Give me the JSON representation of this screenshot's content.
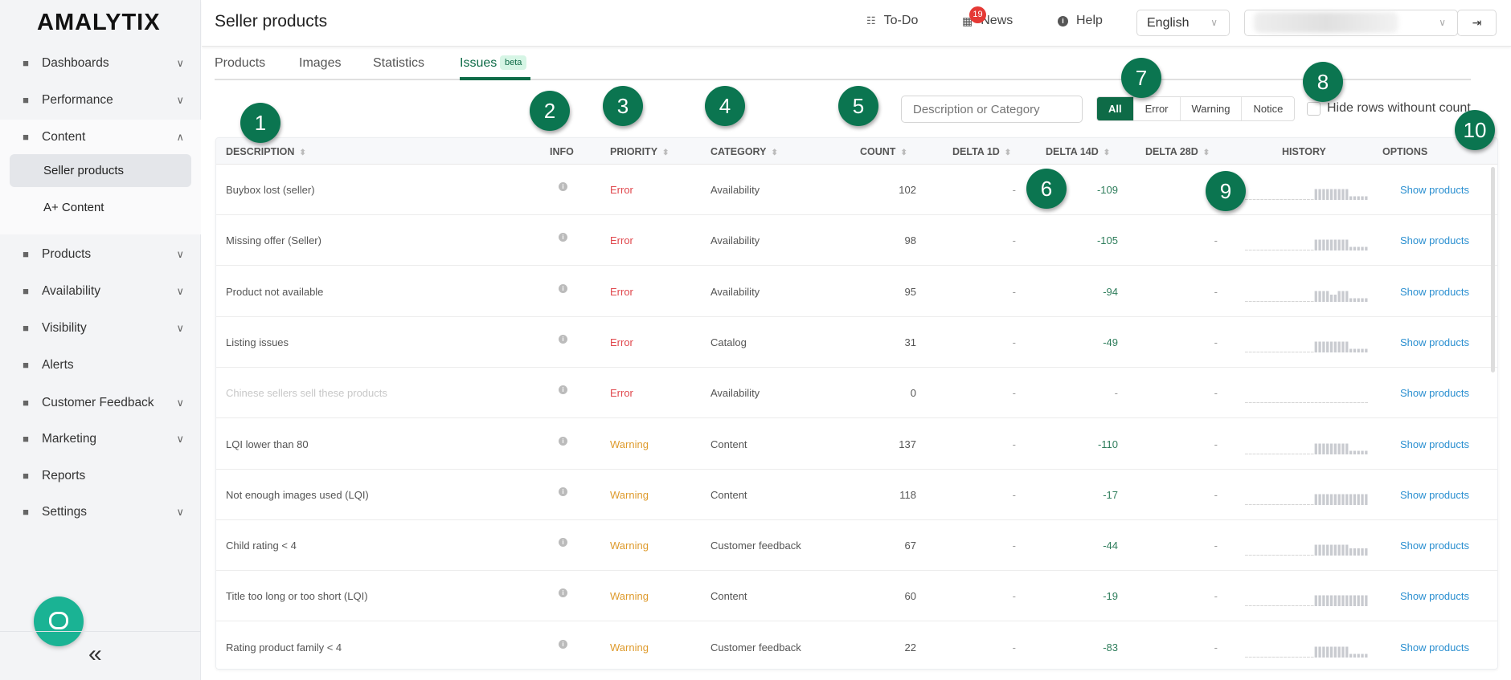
{
  "brand": "AMALYTIX",
  "colors": {
    "accent": "#0e6b47",
    "error": "#e0474c",
    "warning": "#de9a2b",
    "delta": "#2e7d5b",
    "link": "#2a8fd0",
    "callout": "#0b7550"
  },
  "sidebar": {
    "items": [
      {
        "label": "Dashboards",
        "icon": "server-icon",
        "chevron": "down"
      },
      {
        "label": "Performance",
        "icon": "gauge-icon",
        "chevron": "down"
      },
      {
        "label": "Content",
        "icon": "id-card-icon",
        "chevron": "up",
        "children": [
          {
            "label": "Seller products",
            "active": true
          },
          {
            "label": "A+ Content"
          }
        ]
      },
      {
        "label": "Products",
        "icon": "list-icon",
        "chevron": "down"
      },
      {
        "label": "Availability",
        "icon": "thermometer-icon",
        "chevron": "down"
      },
      {
        "label": "Visibility",
        "icon": "search-icon",
        "chevron": "down"
      },
      {
        "label": "Alerts",
        "icon": "bell-icon"
      },
      {
        "label": "Customer Feedback",
        "icon": "star-icon",
        "chevron": "down"
      },
      {
        "label": "Marketing",
        "icon": "megaphone-icon",
        "chevron": "down"
      },
      {
        "label": "Reports",
        "icon": "table-icon"
      },
      {
        "label": "Settings",
        "icon": "sliders-icon",
        "chevron": "down"
      }
    ],
    "collapse": "«"
  },
  "header": {
    "title": "Seller products",
    "todo": "To-Do",
    "news": "News",
    "news_badge": "19",
    "help": "Help",
    "language": "English"
  },
  "tabs": [
    {
      "label": "Products"
    },
    {
      "label": "Images"
    },
    {
      "label": "Statistics"
    },
    {
      "label": "Issues",
      "active": true,
      "badge": "beta"
    }
  ],
  "filters": {
    "search_placeholder": "Description or Category",
    "priority": [
      "All",
      "Error",
      "Warning",
      "Notice"
    ],
    "selected": "All",
    "hide_label": "Hide rows withount count",
    "hide_checked": false
  },
  "columns": [
    "DESCRIPTION",
    "INFO",
    "PRIORITY",
    "CATEGORY",
    "COUNT",
    "DELTA 1D",
    "DELTA 14D",
    "DELTA 28D",
    "HISTORY",
    "OPTIONS"
  ],
  "rows": [
    {
      "description": "Buybox lost (seller)",
      "priority": "Error",
      "category": "Availability",
      "count": "102",
      "d1": "-",
      "d14": "-109",
      "d28": "",
      "history": [
        0,
        0,
        0,
        0,
        0,
        0,
        0,
        0,
        0,
        0,
        0,
        0,
        0,
        0,
        0,
        0,
        0,
        0,
        3,
        3,
        3,
        3,
        3,
        3,
        3,
        3,
        3,
        1,
        1,
        1,
        1,
        1
      ],
      "option": "Show products"
    },
    {
      "description": "Missing offer (Seller)",
      "priority": "Error",
      "category": "Availability",
      "count": "98",
      "d1": "-",
      "d14": "-105",
      "d28": "-",
      "history": [
        0,
        0,
        0,
        0,
        0,
        0,
        0,
        0,
        0,
        0,
        0,
        0,
        0,
        0,
        0,
        0,
        0,
        0,
        3,
        3,
        3,
        3,
        3,
        3,
        3,
        3,
        3,
        1,
        1,
        1,
        1,
        1
      ],
      "option": "Show products"
    },
    {
      "description": "Product not available",
      "priority": "Error",
      "category": "Availability",
      "count": "95",
      "d1": "-",
      "d14": "-94",
      "d28": "-",
      "history": [
        0,
        0,
        0,
        0,
        0,
        0,
        0,
        0,
        0,
        0,
        0,
        0,
        0,
        0,
        0,
        0,
        0,
        0,
        3,
        3,
        3,
        3,
        2,
        2,
        3,
        3,
        3,
        1,
        1,
        1,
        1,
        1
      ],
      "option": "Show products"
    },
    {
      "description": "Listing issues",
      "priority": "Error",
      "category": "Catalog",
      "count": "31",
      "d1": "-",
      "d14": "-49",
      "d28": "-",
      "history": [
        0,
        0,
        0,
        0,
        0,
        0,
        0,
        0,
        0,
        0,
        0,
        0,
        0,
        0,
        0,
        0,
        0,
        0,
        3,
        3,
        3,
        3,
        3,
        3,
        3,
        3,
        3,
        1,
        1,
        1,
        1,
        1
      ],
      "option": "Show products"
    },
    {
      "description": "Chinese sellers sell these products",
      "priority": "Error",
      "category": "Availability",
      "count": "0",
      "d1": "-",
      "d14": "-",
      "d28": "-",
      "muted": true,
      "history": [
        0,
        0,
        0,
        0,
        0,
        0,
        0,
        0,
        0,
        0,
        0,
        0,
        0,
        0,
        0,
        0,
        0,
        0,
        0,
        0,
        0,
        0,
        0,
        0,
        0,
        0,
        0,
        0,
        0,
        0,
        0,
        0
      ],
      "option": "Show products"
    },
    {
      "description": "LQI lower than 80",
      "priority": "Warning",
      "category": "Content",
      "count": "137",
      "d1": "-",
      "d14": "-110",
      "d28": "-",
      "history": [
        0,
        0,
        0,
        0,
        0,
        0,
        0,
        0,
        0,
        0,
        0,
        0,
        0,
        0,
        0,
        0,
        0,
        0,
        3,
        3,
        3,
        3,
        3,
        3,
        3,
        3,
        3,
        1,
        1,
        1,
        1,
        1
      ],
      "option": "Show products"
    },
    {
      "description": "Not enough images used (LQI)",
      "priority": "Warning",
      "category": "Content",
      "count": "118",
      "d1": "-",
      "d14": "-17",
      "d28": "-",
      "history": [
        0,
        0,
        0,
        0,
        0,
        0,
        0,
        0,
        0,
        0,
        0,
        0,
        0,
        0,
        0,
        0,
        0,
        0,
        3,
        3,
        3,
        3,
        3,
        3,
        3,
        3,
        3,
        3,
        3,
        3,
        3,
        3
      ],
      "option": "Show products"
    },
    {
      "description": "Child rating < 4",
      "priority": "Warning",
      "category": "Customer feedback",
      "count": "67",
      "d1": "-",
      "d14": "-44",
      "d28": "-",
      "history": [
        0,
        0,
        0,
        0,
        0,
        0,
        0,
        0,
        0,
        0,
        0,
        0,
        0,
        0,
        0,
        0,
        0,
        0,
        3,
        3,
        3,
        3,
        3,
        3,
        3,
        3,
        3,
        2,
        2,
        2,
        2,
        2
      ],
      "option": "Show products"
    },
    {
      "description": "Title too long or too short (LQI)",
      "priority": "Warning",
      "category": "Content",
      "count": "60",
      "d1": "-",
      "d14": "-19",
      "d28": "-",
      "history": [
        0,
        0,
        0,
        0,
        0,
        0,
        0,
        0,
        0,
        0,
        0,
        0,
        0,
        0,
        0,
        0,
        0,
        0,
        3,
        3,
        3,
        3,
        3,
        3,
        3,
        3,
        3,
        3,
        3,
        3,
        3,
        3
      ],
      "option": "Show products"
    },
    {
      "description": "Rating product family < 4",
      "priority": "Warning",
      "category": "Customer feedback",
      "count": "22",
      "d1": "-",
      "d14": "-83",
      "d28": "-",
      "history": [
        0,
        0,
        0,
        0,
        0,
        0,
        0,
        0,
        0,
        0,
        0,
        0,
        0,
        0,
        0,
        0,
        0,
        0,
        3,
        3,
        3,
        3,
        3,
        3,
        3,
        3,
        3,
        1,
        1,
        1,
        1,
        1
      ],
      "option": "Show products"
    }
  ],
  "callouts": [
    "1",
    "2",
    "3",
    "4",
    "5",
    "6",
    "7",
    "8",
    "9",
    "10"
  ]
}
